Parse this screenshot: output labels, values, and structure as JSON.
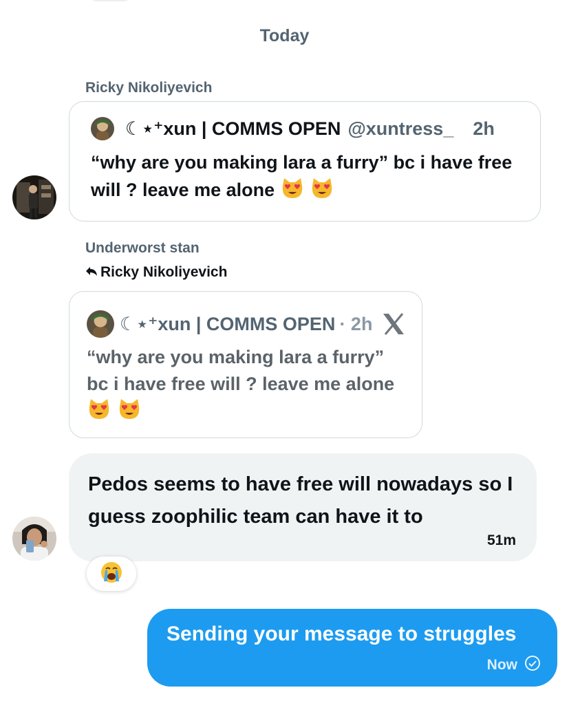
{
  "divider": {
    "label": "Today"
  },
  "messages": [
    {
      "sender": "Ricky Nikoliyevich",
      "card": {
        "author": "☾⋆⁺xun | COMMS OPEN",
        "handle": "@xuntress_",
        "time": "2h",
        "text": "“why are you making lara a furry” bc i have free will ? leave me alone"
      }
    },
    {
      "sender": "Underworst stan",
      "reply_to": "Ricky Nikoliyevich",
      "card": {
        "author": "☾⋆⁺xun | COMMS OPEN",
        "time": "· 2h",
        "text": "“why are you making lara a furry” bc i have free will ? leave me alone"
      }
    },
    {
      "text": "Pedos seems to have free will nowadays so I guess zoophilic team can have it to",
      "time": "51m",
      "reaction_icon": "crying-face-emoji"
    },
    {
      "text": "Sending your message to struggles",
      "status": "Now",
      "status_icon": "check-circle-icon"
    }
  ],
  "colors": {
    "accent": "#1d9bf0",
    "muted_text": "#536471",
    "incoming_bubble": "#eff3f4",
    "card_border": "#cfd9de"
  }
}
